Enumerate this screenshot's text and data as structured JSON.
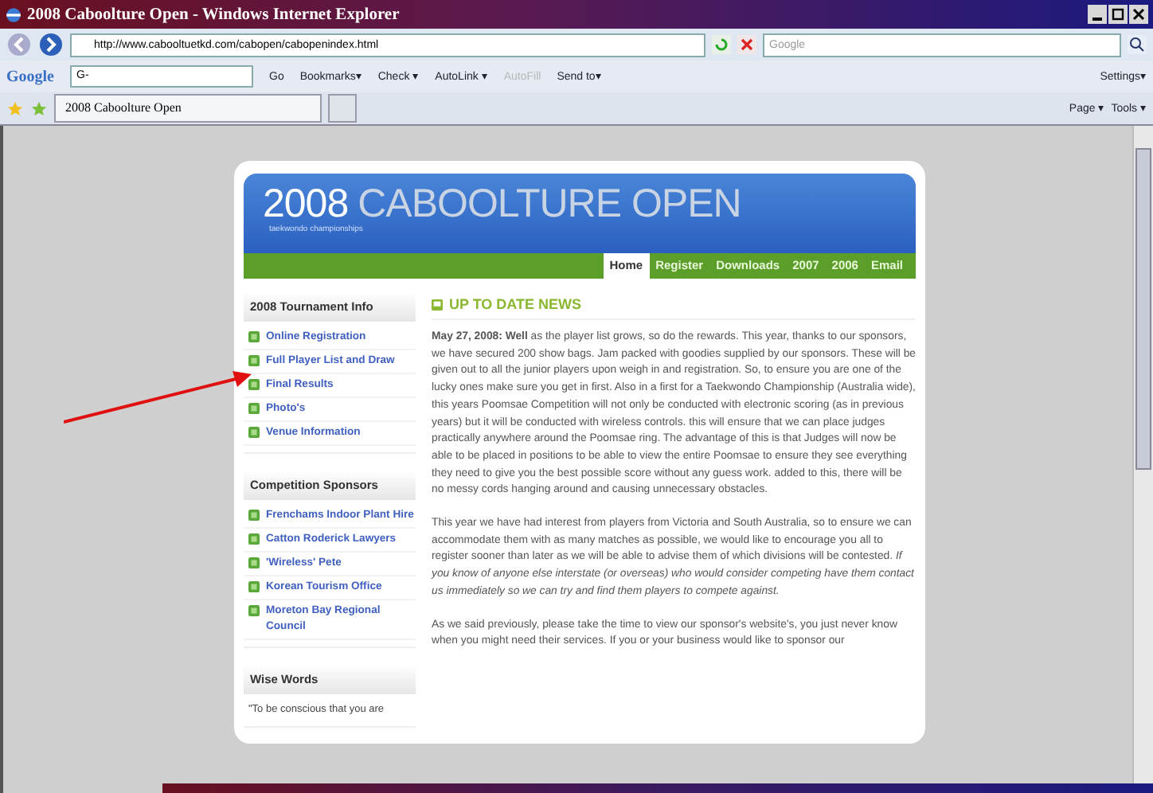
{
  "window": {
    "title": "2008 Caboolture Open - Windows Internet Explorer"
  },
  "address_bar": {
    "url": "http://www.cabooltuetkd.com/cabopen/cabopenindex.html",
    "search_placeholder": "Google"
  },
  "google_toolbar": {
    "logo": "Google",
    "search_value": "G-",
    "items": [
      {
        "label": "Go",
        "disabled": false
      },
      {
        "label": "Bookmarks▾",
        "disabled": false
      },
      {
        "label": "Check ▾",
        "disabled": false
      },
      {
        "label": "AutoLink ▾",
        "disabled": false
      },
      {
        "label": "AutoFill",
        "disabled": true
      },
      {
        "label": "Send to▾",
        "disabled": false
      }
    ],
    "settings": "Settings▾"
  },
  "tab_bar": {
    "tab_title": "2008 Caboolture Open",
    "commands": [
      "Page ▾",
      "Tools ▾"
    ]
  },
  "page": {
    "header": {
      "title_year": "2008",
      "title_name": "CABOOLTURE OPEN",
      "subtitle": "taekwondo championships"
    },
    "nav": [
      {
        "label": "Home",
        "selected": true
      },
      {
        "label": "Register",
        "selected": false
      },
      {
        "label": "Downloads",
        "selected": false
      },
      {
        "label": "2007",
        "selected": false
      },
      {
        "label": "2006",
        "selected": false
      },
      {
        "label": "Email",
        "selected": false
      }
    ],
    "sidebar": [
      {
        "title": "2008 Tournament Info",
        "kind": "links",
        "items": [
          "Online Registration",
          "Full Player List and Draw",
          "Final Results",
          "Photo's",
          "Venue Information"
        ]
      },
      {
        "title": "Competition Sponsors",
        "kind": "links",
        "items": [
          "Frenchams Indoor Plant Hire",
          "Catton Roderick Lawyers",
          "'Wireless' Pete",
          "Korean Tourism Office",
          "Moreton Bay Regional Council"
        ]
      },
      {
        "title": "Wise Words",
        "kind": "quote",
        "items": [
          "\"To be conscious that you are"
        ]
      }
    ],
    "news": {
      "heading": "UP TO DATE NEWS",
      "paragraphs": [
        "**May 27, 2008: Well** as the player list grows, so do the rewards. This year, thanks to our sponsors, we have secured 200 show bags. Jam packed with goodies supplied by our sponsors. These will be given out to all the junior players upon weigh in and registration. So, to ensure you are one of the lucky ones make sure you get in first. Also in a first for a Taekwondo Championship (Australia wide), this years Poomsae Competition will not only be conducted with electronic scoring (as in previous years) but it will be conducted with wireless controls. this will ensure that we can place judges practically anywhere around the Poomsae ring. The advantage of this is that Judges will now be able to be placed in positions to be able to view the entire Poomsae to ensure they see everything they need to give you the best possible score without any guess work. added to this, there will be no messy cords hanging around and causing unnecessary obstacles.",
        "This year we have had interest from players from Victoria and South Australia, so to ensure we can accommodate them with as many matches as possible, we would like to encourage you all to register sooner than later as we will be able to advise them of which divisions will be contested. *If you know of anyone else interstate (or overseas) who would consider competing have them contact us immediately so we can try and find them players to compete against.*",
        "As we said previously, please take the time to view our sponsor's website's, you just never know when you might need their services. If you or your business would like to sponsor our"
      ]
    }
  }
}
